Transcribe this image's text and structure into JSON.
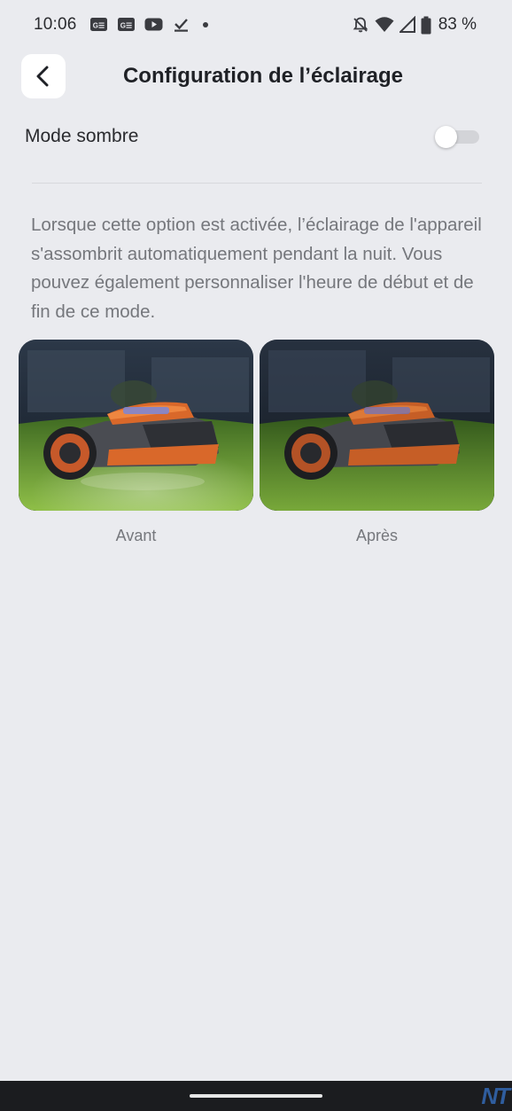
{
  "status_bar": {
    "time": "10:06",
    "battery": "83 %",
    "notification_icons": [
      "news-icon",
      "news-icon",
      "youtube-icon",
      "download-done-icon",
      "dot-icon"
    ],
    "system_icons": [
      "notifications-off-icon",
      "wifi-icon",
      "signal-icon",
      "battery-icon"
    ]
  },
  "header": {
    "title": "Configuration de l’éclairage",
    "back_icon": "chevron-left-icon"
  },
  "dark_mode": {
    "label": "Mode sombre",
    "enabled": false
  },
  "description": "Lorsque cette option est activée, l’éclairage de l'appareil s'assombrit automatiquement pendant la nuit. Vous pouvez également personnaliser l'heure de début et de fin de ce mode.",
  "comparison": {
    "before_label": "Avant",
    "after_label": "Après"
  },
  "watermark": "NT",
  "colors": {
    "background": "#eaebef",
    "title": "#1f2126",
    "description": "#75777c",
    "mower_orange": "#d9682a"
  }
}
